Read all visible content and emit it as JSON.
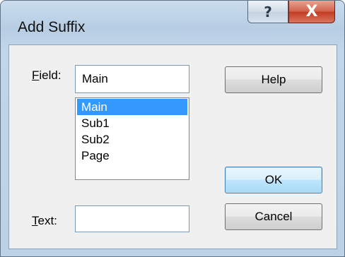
{
  "window": {
    "title": "Add Suffix"
  },
  "caption": {
    "help_glyph": "?",
    "close_glyph": "X"
  },
  "field": {
    "label_prefix": "",
    "label_mnemonic": "F",
    "label_rest": "ield:",
    "value": "Main",
    "options": [
      "Main",
      "Sub1",
      "Sub2",
      "Page"
    ],
    "selected": "Main"
  },
  "text": {
    "label_mnemonic": "T",
    "label_rest": "ext:",
    "value": ""
  },
  "buttons": {
    "help": "Help",
    "ok": "OK",
    "cancel": "Cancel"
  },
  "colors": {
    "selection": "#3399ff",
    "default_button_border": "#3c7fb1",
    "close_button": "#c13a22"
  }
}
